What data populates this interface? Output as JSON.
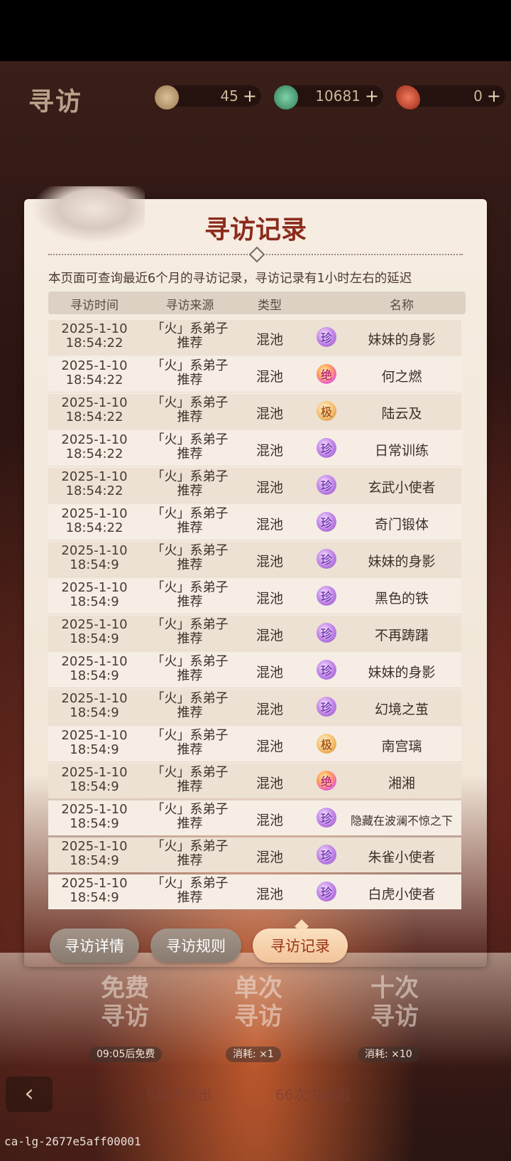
{
  "header": {
    "title": "寻访",
    "resources": [
      {
        "icon": "dice-token-icon",
        "value": "45",
        "plus": "+"
      },
      {
        "icon": "jade-coin-icon",
        "value": "10681",
        "plus": "+"
      },
      {
        "icon": "feather-token-icon",
        "value": "0",
        "plus": "+"
      }
    ]
  },
  "dialog": {
    "title": "寻访记录",
    "notice": "本页面可查询最近6个月的寻访记录，寻访记录有1小时左右的延迟",
    "columns": [
      "寻访时间",
      "寻访来源",
      "类型",
      "名称"
    ],
    "records": [
      {
        "date": "2025-1-10",
        "time": "18:54:22",
        "source_line1": "「火」系弟子",
        "source_line2": "推荐",
        "type": "混池",
        "rarity": "珍",
        "name": "妹妹的身影"
      },
      {
        "date": "2025-1-10",
        "time": "18:54:22",
        "source_line1": "「火」系弟子",
        "source_line2": "推荐",
        "type": "混池",
        "rarity": "绝",
        "name": "何之燃"
      },
      {
        "date": "2025-1-10",
        "time": "18:54:22",
        "source_line1": "「火」系弟子",
        "source_line2": "推荐",
        "type": "混池",
        "rarity": "极",
        "name": "陆云及"
      },
      {
        "date": "2025-1-10",
        "time": "18:54:22",
        "source_line1": "「火」系弟子",
        "source_line2": "推荐",
        "type": "混池",
        "rarity": "珍",
        "name": "日常训练"
      },
      {
        "date": "2025-1-10",
        "time": "18:54:22",
        "source_line1": "「火」系弟子",
        "source_line2": "推荐",
        "type": "混池",
        "rarity": "珍",
        "name": "玄武小使者"
      },
      {
        "date": "2025-1-10",
        "time": "18:54:22",
        "source_line1": "「火」系弟子",
        "source_line2": "推荐",
        "type": "混池",
        "rarity": "珍",
        "name": "奇门锻体"
      },
      {
        "date": "2025-1-10",
        "time": "18:54:9",
        "source_line1": "「火」系弟子",
        "source_line2": "推荐",
        "type": "混池",
        "rarity": "珍",
        "name": "妹妹的身影"
      },
      {
        "date": "2025-1-10",
        "time": "18:54:9",
        "source_line1": "「火」系弟子",
        "source_line2": "推荐",
        "type": "混池",
        "rarity": "珍",
        "name": "黑色的铁"
      },
      {
        "date": "2025-1-10",
        "time": "18:54:9",
        "source_line1": "「火」系弟子",
        "source_line2": "推荐",
        "type": "混池",
        "rarity": "珍",
        "name": "不再踌躇"
      },
      {
        "date": "2025-1-10",
        "time": "18:54:9",
        "source_line1": "「火」系弟子",
        "source_line2": "推荐",
        "type": "混池",
        "rarity": "珍",
        "name": "妹妹的身影"
      },
      {
        "date": "2025-1-10",
        "time": "18:54:9",
        "source_line1": "「火」系弟子",
        "source_line2": "推荐",
        "type": "混池",
        "rarity": "珍",
        "name": "幻境之茧"
      },
      {
        "date": "2025-1-10",
        "time": "18:54:9",
        "source_line1": "「火」系弟子",
        "source_line2": "推荐",
        "type": "混池",
        "rarity": "极",
        "name": "南宫璃"
      },
      {
        "date": "2025-1-10",
        "time": "18:54:9",
        "source_line1": "「火」系弟子",
        "source_line2": "推荐",
        "type": "混池",
        "rarity": "绝",
        "name": "湘湘"
      },
      {
        "date": "2025-1-10",
        "time": "18:54:9",
        "source_line1": "「火」系弟子",
        "source_line2": "推荐",
        "type": "混池",
        "rarity": "珍",
        "name": "隐藏在波澜不惊之下"
      },
      {
        "date": "2025-1-10",
        "time": "18:54:9",
        "source_line1": "「火」系弟子",
        "source_line2": "推荐",
        "type": "混池",
        "rarity": "珍",
        "name": "朱雀小使者"
      },
      {
        "date": "2025-1-10",
        "time": "18:54:9",
        "source_line1": "「火」系弟子",
        "source_line2": "推荐",
        "type": "混池",
        "rarity": "珍",
        "name": "白虎小使者"
      }
    ],
    "tabs": [
      "寻访详情",
      "寻访规则",
      "寻访记录"
    ],
    "active_tab": "寻访记录"
  },
  "background": {
    "big_buttons": [
      {
        "label_top": "免费",
        "label_bottom": "寻访",
        "caption": "09:05后免费"
      },
      {
        "label_top": "单次",
        "label_bottom": "寻访",
        "caption": "消耗: ×1"
      },
      {
        "label_top": "十次",
        "label_bottom": "寻访",
        "caption": "消耗: ×10"
      }
    ],
    "guarantee_left": "5次内必出",
    "guarantee_right": "66次内必出",
    "back_icon": "back-arrow-icon"
  },
  "trace_id": "ca-lg-2677e5aff00001"
}
